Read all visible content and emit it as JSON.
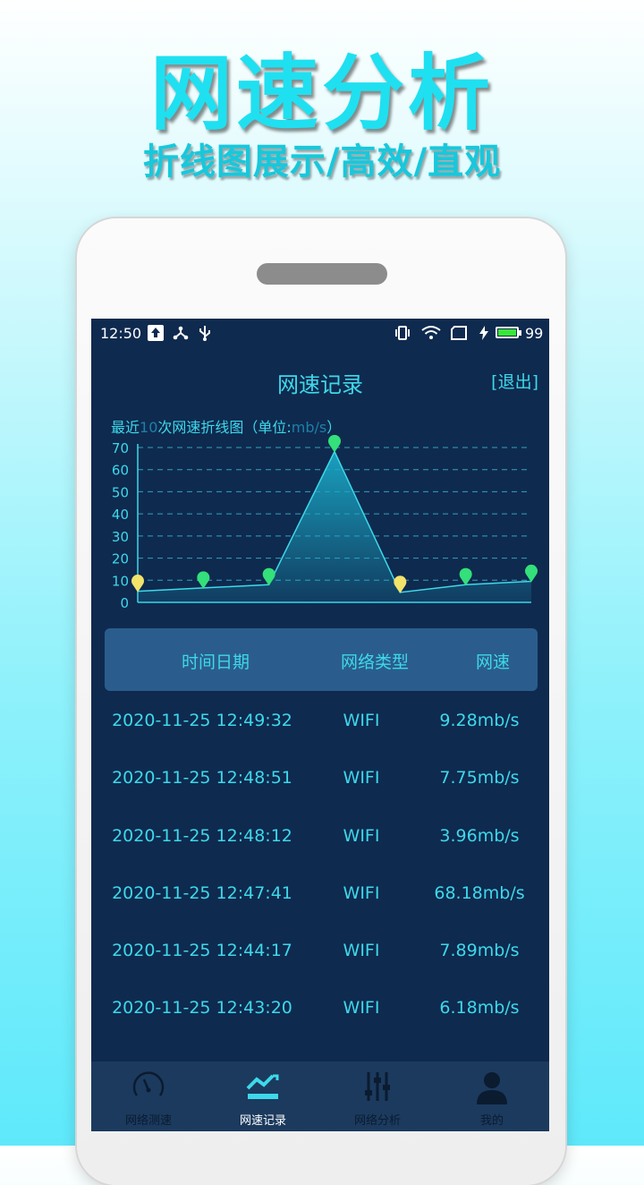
{
  "promo": {
    "title": "网速分析",
    "subtitle": "折线图展示/高效/直观"
  },
  "status_bar": {
    "time": "12:50",
    "battery": "99",
    "battery_level": 0.99,
    "icons": [
      "upload-icon",
      "share-icon",
      "usb-icon",
      "vibrate-icon",
      "wifi-icon",
      "screen-icon",
      "charging-icon",
      "battery-icon"
    ]
  },
  "header": {
    "title": "网速记录",
    "exit_label": "[退出]"
  },
  "chart_caption": {
    "prefix": "最近",
    "count": "10",
    "middle": "次网速折线图（单位:",
    "unit": "mb/s",
    "suffix": "）"
  },
  "chart_data": {
    "type": "area",
    "title": "最近10次网速折线图（单位: mb/s）",
    "ylabel": "",
    "xlabel": "",
    "ylim": [
      0,
      70
    ],
    "yticks": [
      "70",
      "60",
      "50",
      "40",
      "30",
      "20",
      "10",
      "0"
    ],
    "grid": true,
    "values": [
      5,
      6.5,
      8,
      68.18,
      4.5,
      8,
      9.5
    ],
    "markers": [
      "yellow",
      "green",
      "green",
      "green",
      "yellow",
      "green",
      "green"
    ],
    "colors": {
      "line": "#3ed8ea",
      "fill": "#1aa6c4",
      "marker_green": "#33e07a",
      "marker_yellow": "#f2e36a",
      "grid": "#3ed8ea"
    }
  },
  "table": {
    "headers": [
      "时间日期",
      "网络类型",
      "网速"
    ],
    "rows": [
      [
        "2020-11-25 12:49:32",
        "WIFI",
        "9.28mb/s"
      ],
      [
        "2020-11-25 12:48:51",
        "WIFI",
        "7.75mb/s"
      ],
      [
        "2020-11-25 12:48:12",
        "WIFI",
        "3.96mb/s"
      ],
      [
        "2020-11-25 12:47:41",
        "WIFI",
        "68.18mb/s"
      ],
      [
        "2020-11-25 12:44:17",
        "WIFI",
        "7.89mb/s"
      ],
      [
        "2020-11-25 12:43:20",
        "WIFI",
        "6.18mb/s"
      ]
    ]
  },
  "bottom_nav": {
    "items": [
      {
        "label": "网络测速",
        "icon": "speedometer-icon",
        "active": false
      },
      {
        "label": "网速记录",
        "icon": "line-chart-icon",
        "active": true
      },
      {
        "label": "网络分析",
        "icon": "sliders-icon",
        "active": false
      },
      {
        "label": "我的",
        "icon": "user-icon",
        "active": false
      }
    ]
  },
  "colors": {
    "accent": "#3ed8ea",
    "screen_bg": "#0f2a4f",
    "header_bg": "#2a5d8d",
    "nav_bg": "#1b3a5e"
  }
}
